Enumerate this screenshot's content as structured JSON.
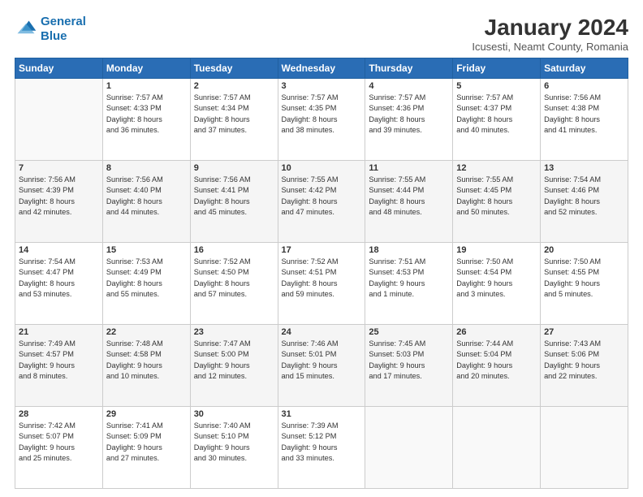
{
  "header": {
    "logo_line1": "General",
    "logo_line2": "Blue",
    "title": "January 2024",
    "subtitle": "Icusesti, Neamt County, Romania"
  },
  "days_of_week": [
    "Sunday",
    "Monday",
    "Tuesday",
    "Wednesday",
    "Thursday",
    "Friday",
    "Saturday"
  ],
  "weeks": [
    [
      {
        "day": "",
        "info": ""
      },
      {
        "day": "1",
        "info": "Sunrise: 7:57 AM\nSunset: 4:33 PM\nDaylight: 8 hours\nand 36 minutes."
      },
      {
        "day": "2",
        "info": "Sunrise: 7:57 AM\nSunset: 4:34 PM\nDaylight: 8 hours\nand 37 minutes."
      },
      {
        "day": "3",
        "info": "Sunrise: 7:57 AM\nSunset: 4:35 PM\nDaylight: 8 hours\nand 38 minutes."
      },
      {
        "day": "4",
        "info": "Sunrise: 7:57 AM\nSunset: 4:36 PM\nDaylight: 8 hours\nand 39 minutes."
      },
      {
        "day": "5",
        "info": "Sunrise: 7:57 AM\nSunset: 4:37 PM\nDaylight: 8 hours\nand 40 minutes."
      },
      {
        "day": "6",
        "info": "Sunrise: 7:56 AM\nSunset: 4:38 PM\nDaylight: 8 hours\nand 41 minutes."
      }
    ],
    [
      {
        "day": "7",
        "info": "Sunrise: 7:56 AM\nSunset: 4:39 PM\nDaylight: 8 hours\nand 42 minutes."
      },
      {
        "day": "8",
        "info": "Sunrise: 7:56 AM\nSunset: 4:40 PM\nDaylight: 8 hours\nand 44 minutes."
      },
      {
        "day": "9",
        "info": "Sunrise: 7:56 AM\nSunset: 4:41 PM\nDaylight: 8 hours\nand 45 minutes."
      },
      {
        "day": "10",
        "info": "Sunrise: 7:55 AM\nSunset: 4:42 PM\nDaylight: 8 hours\nand 47 minutes."
      },
      {
        "day": "11",
        "info": "Sunrise: 7:55 AM\nSunset: 4:44 PM\nDaylight: 8 hours\nand 48 minutes."
      },
      {
        "day": "12",
        "info": "Sunrise: 7:55 AM\nSunset: 4:45 PM\nDaylight: 8 hours\nand 50 minutes."
      },
      {
        "day": "13",
        "info": "Sunrise: 7:54 AM\nSunset: 4:46 PM\nDaylight: 8 hours\nand 52 minutes."
      }
    ],
    [
      {
        "day": "14",
        "info": "Sunrise: 7:54 AM\nSunset: 4:47 PM\nDaylight: 8 hours\nand 53 minutes."
      },
      {
        "day": "15",
        "info": "Sunrise: 7:53 AM\nSunset: 4:49 PM\nDaylight: 8 hours\nand 55 minutes."
      },
      {
        "day": "16",
        "info": "Sunrise: 7:52 AM\nSunset: 4:50 PM\nDaylight: 8 hours\nand 57 minutes."
      },
      {
        "day": "17",
        "info": "Sunrise: 7:52 AM\nSunset: 4:51 PM\nDaylight: 8 hours\nand 59 minutes."
      },
      {
        "day": "18",
        "info": "Sunrise: 7:51 AM\nSunset: 4:53 PM\nDaylight: 9 hours\nand 1 minute."
      },
      {
        "day": "19",
        "info": "Sunrise: 7:50 AM\nSunset: 4:54 PM\nDaylight: 9 hours\nand 3 minutes."
      },
      {
        "day": "20",
        "info": "Sunrise: 7:50 AM\nSunset: 4:55 PM\nDaylight: 9 hours\nand 5 minutes."
      }
    ],
    [
      {
        "day": "21",
        "info": "Sunrise: 7:49 AM\nSunset: 4:57 PM\nDaylight: 9 hours\nand 8 minutes."
      },
      {
        "day": "22",
        "info": "Sunrise: 7:48 AM\nSunset: 4:58 PM\nDaylight: 9 hours\nand 10 minutes."
      },
      {
        "day": "23",
        "info": "Sunrise: 7:47 AM\nSunset: 5:00 PM\nDaylight: 9 hours\nand 12 minutes."
      },
      {
        "day": "24",
        "info": "Sunrise: 7:46 AM\nSunset: 5:01 PM\nDaylight: 9 hours\nand 15 minutes."
      },
      {
        "day": "25",
        "info": "Sunrise: 7:45 AM\nSunset: 5:03 PM\nDaylight: 9 hours\nand 17 minutes."
      },
      {
        "day": "26",
        "info": "Sunrise: 7:44 AM\nSunset: 5:04 PM\nDaylight: 9 hours\nand 20 minutes."
      },
      {
        "day": "27",
        "info": "Sunrise: 7:43 AM\nSunset: 5:06 PM\nDaylight: 9 hours\nand 22 minutes."
      }
    ],
    [
      {
        "day": "28",
        "info": "Sunrise: 7:42 AM\nSunset: 5:07 PM\nDaylight: 9 hours\nand 25 minutes."
      },
      {
        "day": "29",
        "info": "Sunrise: 7:41 AM\nSunset: 5:09 PM\nDaylight: 9 hours\nand 27 minutes."
      },
      {
        "day": "30",
        "info": "Sunrise: 7:40 AM\nSunset: 5:10 PM\nDaylight: 9 hours\nand 30 minutes."
      },
      {
        "day": "31",
        "info": "Sunrise: 7:39 AM\nSunset: 5:12 PM\nDaylight: 9 hours\nand 33 minutes."
      },
      {
        "day": "",
        "info": ""
      },
      {
        "day": "",
        "info": ""
      },
      {
        "day": "",
        "info": ""
      }
    ]
  ]
}
